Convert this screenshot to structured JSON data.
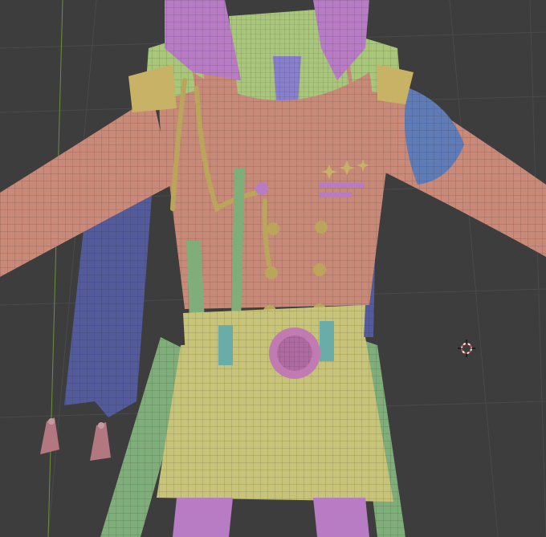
{
  "app": {
    "viewport": {
      "background": "#3d3d3d",
      "grid_line_color": "#4a4a4a",
      "y_axis_color": "#6b8f3a"
    },
    "scene": {
      "object": "3d-character-mesh",
      "wireframe_overlay": true,
      "material_colors": {
        "skin": "#c98a7a",
        "collar": "#a8c77a",
        "jacket": "#c88a78",
        "trim_green": "#7fae7a",
        "purple": "#b77cc4",
        "blue_band": "#5f7cb6",
        "sash": "#535b9b",
        "skirt": "#c7c47a",
        "belt": "#c7c47a",
        "buckle": "#c27ab2",
        "gold": "#b9a65a",
        "teal": "#6aaca8"
      }
    },
    "icons": {
      "cursor": "3d-cursor-icon"
    }
  }
}
